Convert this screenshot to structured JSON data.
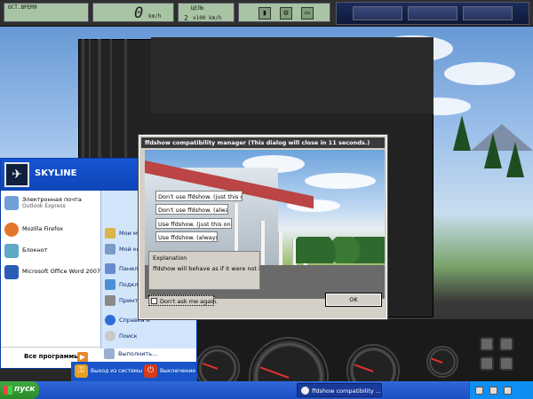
{
  "hud": {
    "label_left": "ОСТ.ВРЕМЯ",
    "speed_value": "0",
    "speed_unit": "km/h",
    "gear_label": "ЦЕЛЬ",
    "distance_value": "2",
    "distance_unit": "x100 km/h",
    "icons": [
      "fuel-icon",
      "engine-icon",
      "battery-icon"
    ]
  },
  "start_menu": {
    "user_name": "SKYLINE",
    "left_items": [
      {
        "label": "Электронная почта",
        "sub": "Outlook Express",
        "icon": "email-icon"
      },
      {
        "label": "Mozilla Firefox",
        "sub": "",
        "icon": "firefox-icon"
      },
      {
        "label": "Блокнот",
        "sub": "",
        "icon": "notepad-icon"
      },
      {
        "label": "Microsoft Office Word 2007",
        "sub": "",
        "icon": "word-icon"
      }
    ],
    "right_items": [
      {
        "label": "Мои му",
        "icon": "music-folder-icon"
      },
      {
        "label": "Мой ко",
        "icon": "my-computer-icon"
      },
      {
        "label": "Панель уп",
        "icon": "control-panel-icon"
      },
      {
        "label": "Подклю",
        "icon": "network-icon"
      },
      {
        "label": "Принтер",
        "icon": "printer-icon"
      },
      {
        "label": "Справка и",
        "icon": "help-icon"
      },
      {
        "label": "Поиск",
        "icon": "search-icon"
      },
      {
        "label": "Выполнить...",
        "icon": "run-icon"
      }
    ],
    "all_programs": "Все программы"
  },
  "logoff": {
    "logoff_label": "Выход из системы",
    "shutdown_label": "Выключение"
  },
  "taskbar": {
    "start_label": "пуск",
    "task_label": "ffdshow compatibility ..."
  },
  "dialog": {
    "title": "ffdshow compatibility manager  (This dialog will close in 11 seconds.)",
    "options": [
      "Don't use ffdshow. (just this once)",
      "Don't use ffdshow. (always)",
      "Use ffdshow. (just this once)",
      "Use ffdshow. (always)"
    ],
    "explanation_title": "Explanation",
    "explanation_text": "ffdshow will behave as if it were not installed.",
    "dont_ask_label": "Don't ask me again.",
    "ok_label": "OK"
  }
}
